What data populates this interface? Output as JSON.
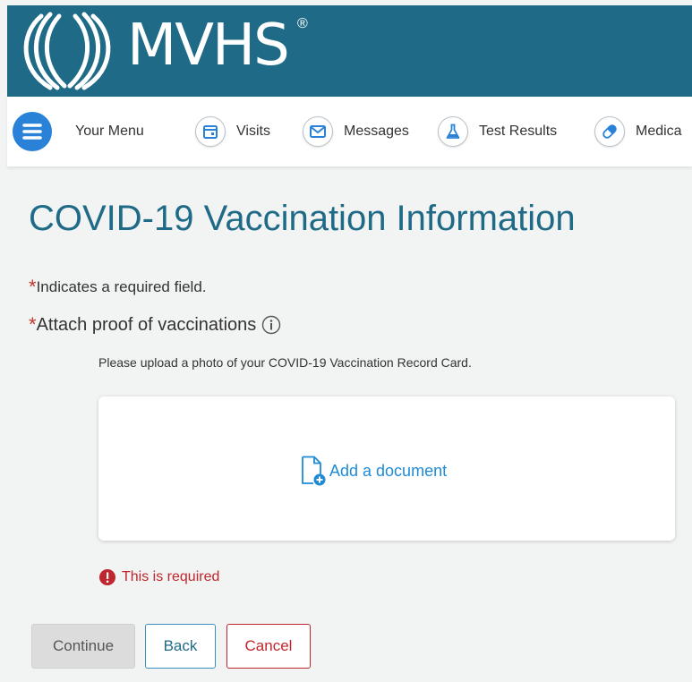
{
  "brand": {
    "name": "MVHS",
    "registered": "®"
  },
  "nav": {
    "items": [
      {
        "label": "Your Menu",
        "icon": "hamburger-menu-icon"
      },
      {
        "label": "Visits",
        "icon": "calendar-icon"
      },
      {
        "label": "Messages",
        "icon": "envelope-icon"
      },
      {
        "label": "Test Results",
        "icon": "flask-icon"
      },
      {
        "label": "Medica",
        "icon": "pill-icon"
      }
    ]
  },
  "page": {
    "title": "COVID-19 Vaccination Information",
    "required_note": "Indicates a required field.",
    "required_marker": "*",
    "attach_label": "Attach proof of vaccinations",
    "helper_text": "Please upload a photo of your COVID-19 Vaccination Record Card.",
    "add_document": "Add a document",
    "error_text": "This is required"
  },
  "buttons": {
    "continue": "Continue",
    "back": "Back",
    "cancel": "Cancel"
  },
  "colors": {
    "header": "#1f6b87",
    "accent": "#1f8bd6",
    "menu": "#2a82d8",
    "error": "#c0262d",
    "background": "#f2f3f3"
  }
}
